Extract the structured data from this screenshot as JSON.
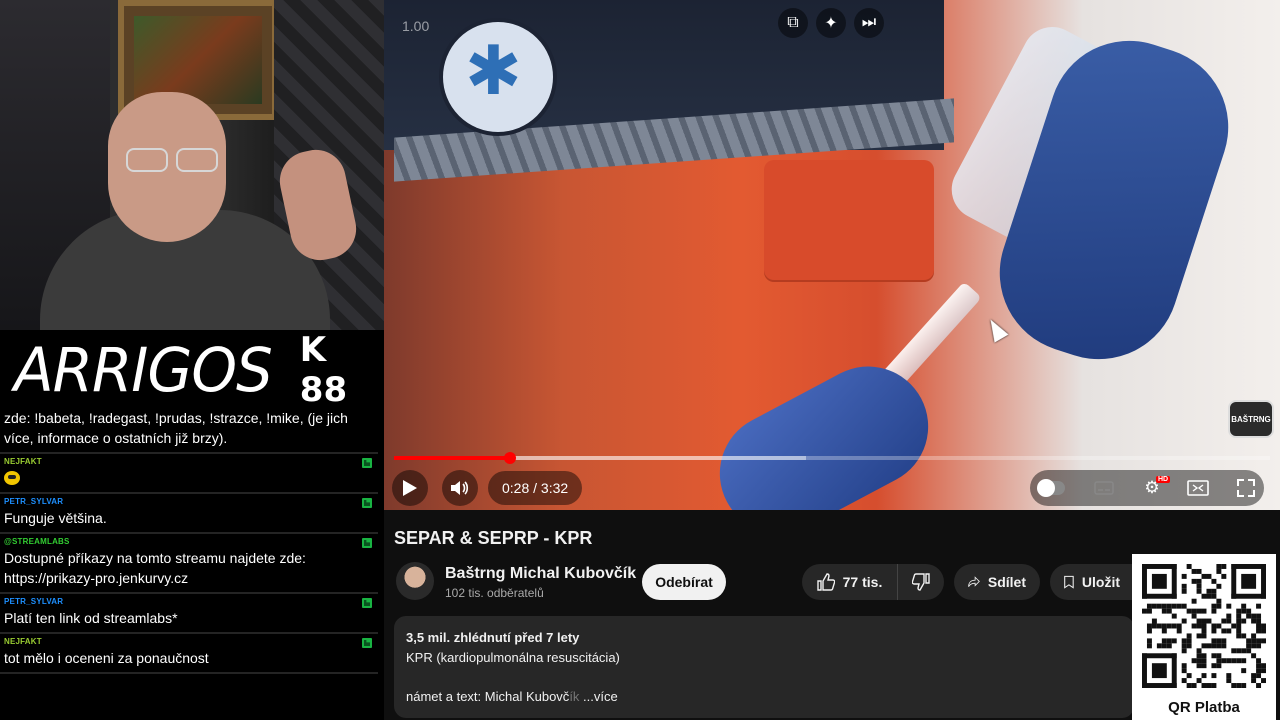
{
  "stream": {
    "logo_text": "ARRIGOS",
    "logo_number": "K 88"
  },
  "chat": {
    "pinned": "zde: !babeta, !radegast, !prudas, !strazce, !mike, (je jich více, informace o ostatních již brzy).",
    "messages": [
      {
        "author": "NEJFAKT",
        "author_color": "#9acd32",
        "text": "",
        "emoji": true
      },
      {
        "author": "PETR_SYLVAR",
        "author_color": "#1e90ff",
        "text": "Funguje většina."
      },
      {
        "author": "@STREAMLABS",
        "author_color": "#32cd32",
        "text": "Dostupné příkazy na tomto streamu najdete zde: https://prikazy-pro.jenkurvy.cz"
      },
      {
        "author": "PETR_SYLVAR",
        "author_color": "#1e90ff",
        "text": "Platí ten link od streamlabs*"
      },
      {
        "author": "NEJFAKT",
        "author_color": "#9acd32",
        "text": "tot mělo i oceneni za ponaučnost"
      }
    ]
  },
  "player": {
    "speed_label": "1.00",
    "time": "0:28 / 3:32",
    "progress_fraction": 0.132,
    "watermark": "BAŠTRNG",
    "accent_color": "#ff0000"
  },
  "video": {
    "title": "SEPAR & SEPRP - KPR",
    "channel": "Baštrng Michal Kubovčík",
    "subscribers": "102 tis. odběratelů",
    "subscribe_label": "Odebírat",
    "likes": "77 tis.",
    "share_label": "Sdílet",
    "save_label": "Uložit"
  },
  "description": {
    "stats": "3,5 mil. zhlédnutí  před 7 lety",
    "line1": "KPR (kardiopulmonálna resuscitácia)",
    "line3_main": "námet a text: Michal Kubovč",
    "line3_fade": "ík",
    "more": " ...více"
  },
  "qr": {
    "label": "QR Platba"
  }
}
